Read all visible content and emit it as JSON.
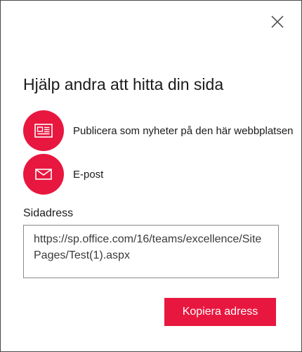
{
  "dialog": {
    "close_icon": "close-icon",
    "title": "Hjälp andra att hitta din sida",
    "share_options": [
      {
        "icon": "newspaper-icon",
        "label": "Publicera som nyheter på den här webbplatsen"
      },
      {
        "icon": "mail-icon",
        "label": "E-post"
      }
    ],
    "address": {
      "label": "Sidadress",
      "value": "https://sp.office.com/16/teams/excellence/SitePages/Test(1).aspx"
    },
    "copy_button_label": "Kopiera adress"
  },
  "colors": {
    "accent": "#e8173f",
    "text": "#1a1a1a",
    "border": "#8a8a8a"
  }
}
